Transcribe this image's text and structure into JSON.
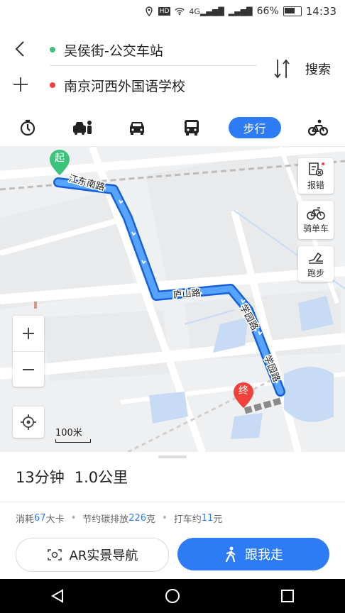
{
  "status_bar": {
    "icons": [
      "location-icon",
      "hd-icon",
      "wifi-icon",
      "signal-4g-icon",
      "signal-icon",
      "battery-icon"
    ],
    "network": "4G",
    "battery": "66%",
    "time": "14:33"
  },
  "route": {
    "from": "吴侯街-公交车站",
    "to": "南京河西外国语学校",
    "from_color": "#3cc27a",
    "to_color": "#f0413c",
    "search_label": "搜索"
  },
  "modes": {
    "items": [
      "timer-icon",
      "taxi-icon",
      "car-icon",
      "bus-icon",
      "步行",
      "bike-icon"
    ],
    "active_label": "步行",
    "accent": "#2d7cf6"
  },
  "map": {
    "start_label": "起",
    "end_label": "终",
    "roads": [
      "江东南路",
      "庐山路",
      "学园路",
      "学园路"
    ],
    "tools": [
      {
        "label": "报错",
        "icon": "report-icon"
      },
      {
        "label": "骑单车",
        "icon": "bike-share-icon"
      },
      {
        "label": "跑步",
        "icon": "run-icon"
      }
    ],
    "scale_label": "100米"
  },
  "summary": {
    "time": "13分钟",
    "distance": "1.0公里",
    "calories_prefix": "消耗",
    "calories": "67",
    "calories_suffix": "大卡",
    "carbon_prefix": "节约碳排放",
    "carbon": "226",
    "carbon_suffix": "克",
    "taxi_prefix": "打车约",
    "taxi": "11",
    "taxi_suffix": "元"
  },
  "actions": {
    "ar_label": "AR实景导航",
    "follow_label": "跟我走"
  }
}
